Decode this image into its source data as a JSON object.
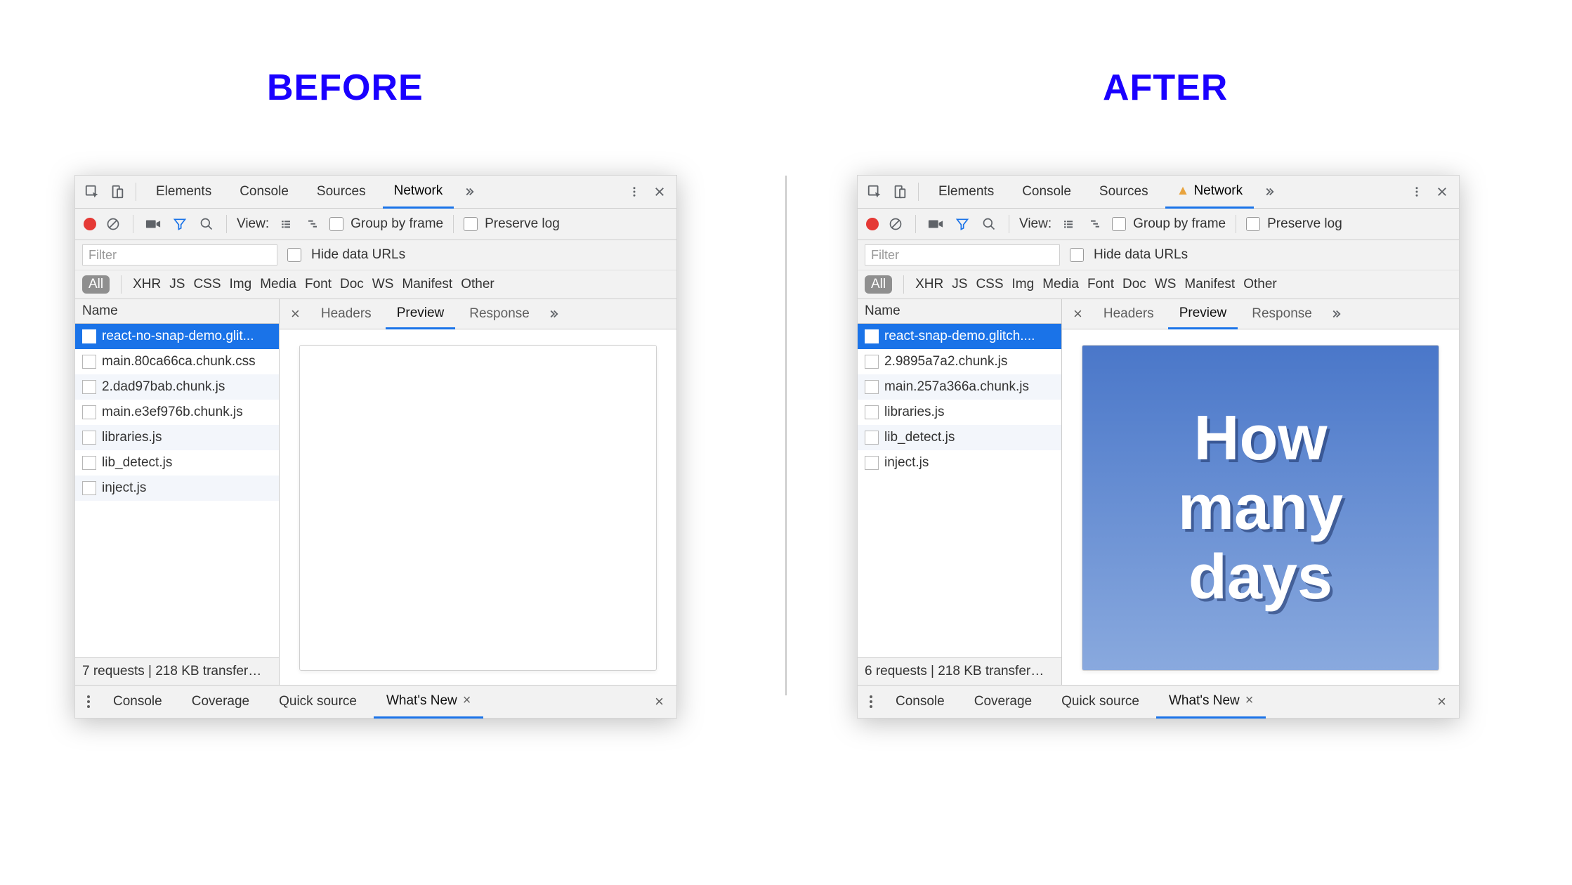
{
  "labels": {
    "before": "BEFORE",
    "after": "AFTER"
  },
  "topTabs": {
    "elements": "Elements",
    "console": "Console",
    "sources": "Sources",
    "network": "Network"
  },
  "toolbar": {
    "view": "View:",
    "groupByFrame": "Group by frame",
    "preserveLog": "Preserve log"
  },
  "filter": {
    "placeholder": "Filter",
    "hideData": "Hide data URLs"
  },
  "types": [
    "All",
    "XHR",
    "JS",
    "CSS",
    "Img",
    "Media",
    "Font",
    "Doc",
    "WS",
    "Manifest",
    "Other"
  ],
  "listHeader": "Name",
  "detailTabs": {
    "headers": "Headers",
    "preview": "Preview",
    "response": "Response"
  },
  "drawer": {
    "console": "Console",
    "coverage": "Coverage",
    "quickSource": "Quick source",
    "whatsNew": "What's New"
  },
  "before": {
    "items": [
      "react-no-snap-demo.glit...",
      "main.80ca66ca.chunk.css",
      "2.dad97bab.chunk.js",
      "main.e3ef976b.chunk.js",
      "libraries.js",
      "lib_detect.js",
      "inject.js"
    ],
    "status": "7 requests | 218 KB transfer…"
  },
  "after": {
    "items": [
      "react-snap-demo.glitch....",
      "2.9895a7a2.chunk.js",
      "main.257a366a.chunk.js",
      "libraries.js",
      "lib_detect.js",
      "inject.js"
    ],
    "status": "6 requests | 218 KB transfer…",
    "poster": "How\nmany\ndays"
  }
}
